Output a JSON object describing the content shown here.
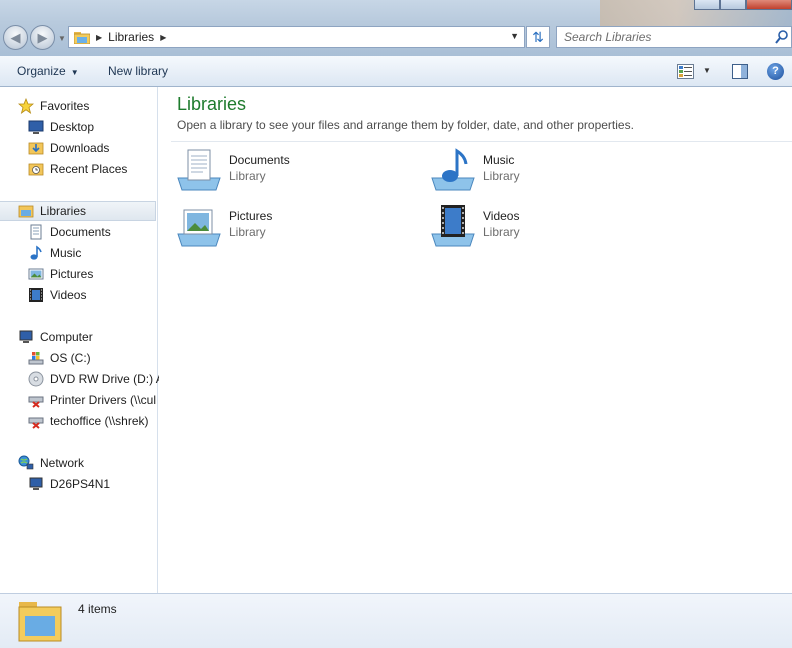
{
  "window": {
    "caption_buttons": [
      "minimize",
      "maximize",
      "close"
    ],
    "close_glyph": "x"
  },
  "address_bar": {
    "breadcrumb": [
      "Libraries"
    ],
    "icon": "libraries-folder-icon"
  },
  "search": {
    "placeholder": "Search Libraries"
  },
  "toolbar": {
    "organize_label": "Organize",
    "new_library_label": "New library"
  },
  "nav": {
    "favorites": {
      "label": "Favorites",
      "items": [
        "Desktop",
        "Downloads",
        "Recent Places"
      ]
    },
    "libraries": {
      "label": "Libraries",
      "items": [
        "Documents",
        "Music",
        "Pictures",
        "Videos"
      ]
    },
    "computer": {
      "label": "Computer",
      "items": [
        "OS (C:)",
        "DVD RW Drive (D:) A",
        "Printer Drivers (\\\\cul",
        "techoffice (\\\\shrek)"
      ]
    },
    "network": {
      "label": "Network",
      "items": [
        "D26PS4N1"
      ]
    }
  },
  "content": {
    "title": "Libraries",
    "subtitle": "Open a library to see your files and arrange them by folder, date, and other properties.",
    "libraries": [
      {
        "name": "Documents",
        "type": "Library",
        "icon": "documents-library-icon"
      },
      {
        "name": "Music",
        "type": "Library",
        "icon": "music-library-icon"
      },
      {
        "name": "Pictures",
        "type": "Library",
        "icon": "pictures-library-icon"
      },
      {
        "name": "Videos",
        "type": "Library",
        "icon": "videos-library-icon"
      }
    ]
  },
  "details_pane": {
    "count_text": "4 items"
  },
  "colors": {
    "title_green": "#1e7b2d",
    "toolbar_text": "#1e3653",
    "accent_blue": "#2a6fc0"
  }
}
